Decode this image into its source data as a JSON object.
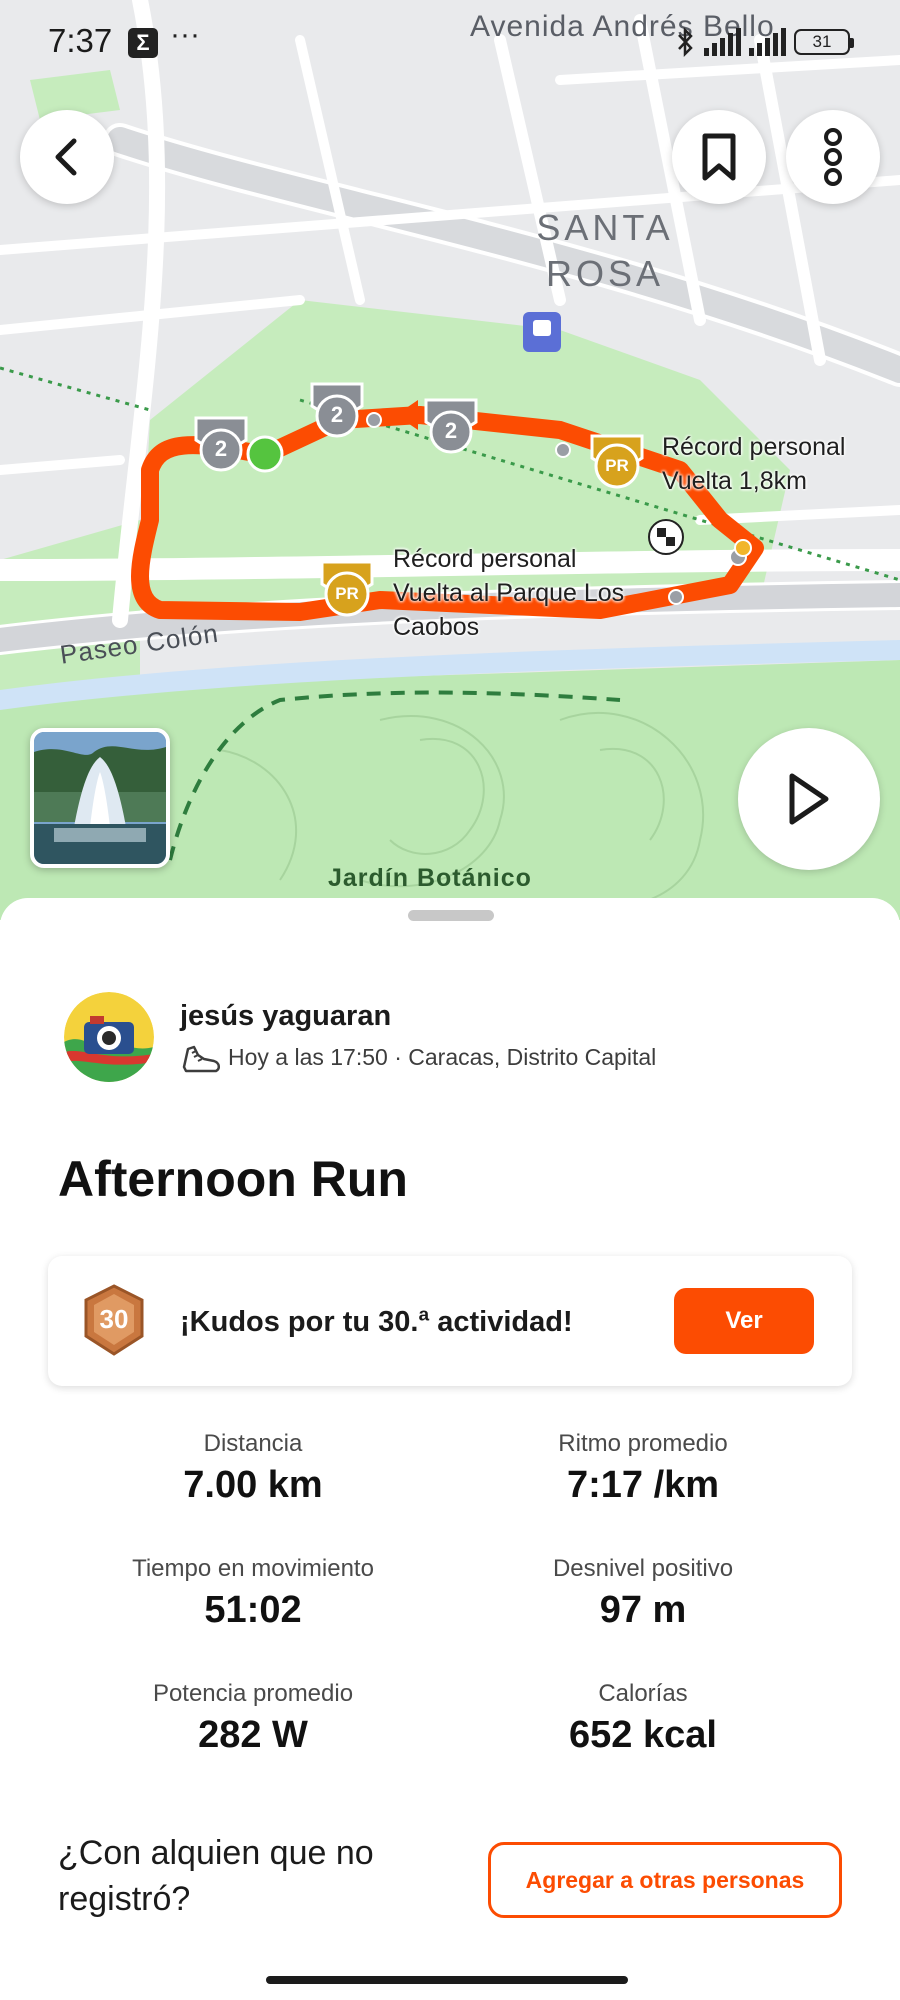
{
  "status_bar": {
    "time": "7:37",
    "sigma": "Σ",
    "dots": "···",
    "battery": "31"
  },
  "map": {
    "labels": {
      "santa_rosa": "SANTA ROSA",
      "avenida": "Avenida Andrés Bello",
      "paseo": "Paseo Colón",
      "jardin": "Jardín Botánico"
    },
    "segment_badge": "2",
    "pr_badge": "PR",
    "pr_1": {
      "line1": "Récord personal",
      "line2": "Vuelta 1,8km"
    },
    "pr_2": {
      "line1": "Récord personal",
      "line2": "Vuelta al Parque Los",
      "line3": "Caobos"
    },
    "route_color": "#fc4c02"
  },
  "athlete": {
    "name": "jesús yaguaran",
    "meta": "Hoy a las 17:50 · Caracas, Distrito Capital"
  },
  "activity": {
    "title": "Afternoon Run"
  },
  "kudos": {
    "badge_number": "30",
    "text": "¡Kudos por tu 30.ª actividad!",
    "button": "Ver"
  },
  "stats": [
    {
      "label": "Distancia",
      "value": "7.00 km"
    },
    {
      "label": "Ritmo promedio",
      "value": "7:17 /km"
    },
    {
      "label": "Tiempo en movimiento",
      "value": "51:02"
    },
    {
      "label": "Desnivel positivo",
      "value": "97 m"
    },
    {
      "label": "Potencia promedio",
      "value": "282 W"
    },
    {
      "label": "Calorías",
      "value": "652 kcal"
    }
  ],
  "tag": {
    "prompt": "¿Con alquien que no registró?",
    "button": "Agregar a otras personas"
  },
  "colors": {
    "accent": "#fc4c02",
    "park": "#bde8b4",
    "water": "#cfe3f7"
  }
}
